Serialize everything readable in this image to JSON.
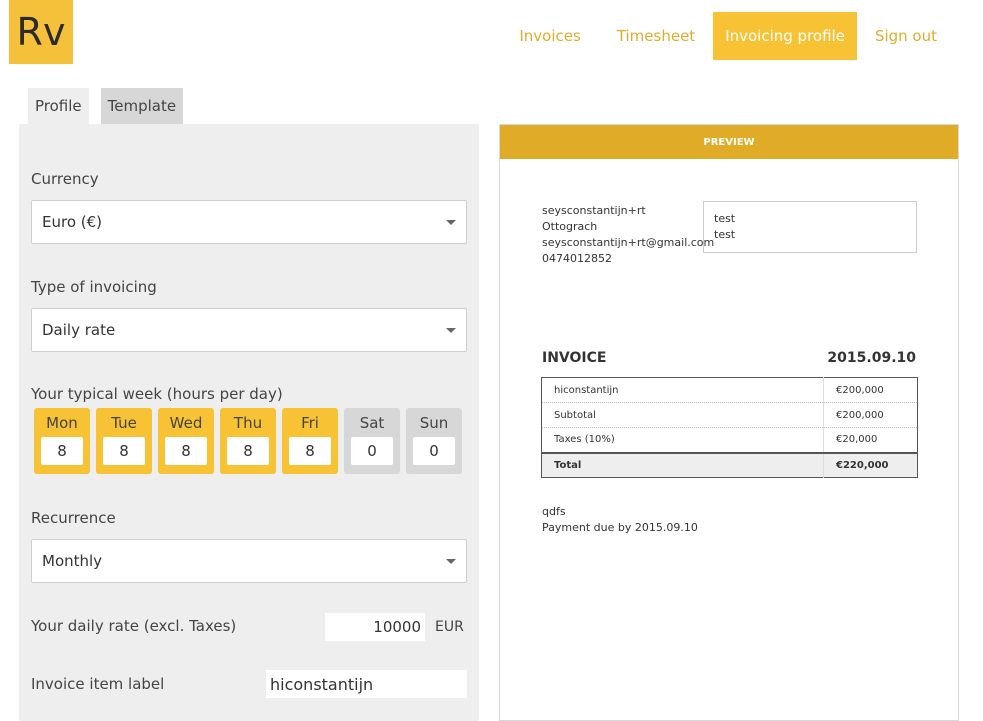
{
  "logo": {
    "text": "Rv"
  },
  "nav": {
    "items": [
      {
        "label": "Invoices"
      },
      {
        "label": "Timesheet"
      },
      {
        "label": "Invoicing profile"
      },
      {
        "label": "Sign out"
      }
    ],
    "active_index": 2
  },
  "tabs": [
    {
      "label": "Profile"
    },
    {
      "label": "Template"
    }
  ],
  "form": {
    "currency_label": "Currency",
    "currency_value": "Euro (€)",
    "invoicing_type_label": "Type of invoicing",
    "invoicing_type_value": "Daily rate",
    "week_label": "Your typical week (hours per day)",
    "days": [
      {
        "name": "Mon",
        "hours": "8",
        "active": true
      },
      {
        "name": "Tue",
        "hours": "8",
        "active": true
      },
      {
        "name": "Wed",
        "hours": "8",
        "active": true
      },
      {
        "name": "Thu",
        "hours": "8",
        "active": true
      },
      {
        "name": "Fri",
        "hours": "8",
        "active": true
      },
      {
        "name": "Sat",
        "hours": "0",
        "active": false
      },
      {
        "name": "Sun",
        "hours": "0",
        "active": false
      }
    ],
    "recurrence_label": "Recurrence",
    "recurrence_value": "Monthly",
    "rate_label": "Your daily rate (excl. Taxes)",
    "rate_value": "10000",
    "rate_unit": "EUR",
    "item_label_label": "Invoice item label",
    "item_label_value": "hiconstantijn"
  },
  "preview": {
    "header": "PREVIEW",
    "sender": {
      "name": "seysconstantijn+rt",
      "city": "Ottograch",
      "email": "seysconstantijn+rt@gmail.com",
      "phone": "0474012852"
    },
    "recipient": {
      "line1": "test",
      "line2": "test"
    },
    "title": "INVOICE",
    "date": "2015.09.10",
    "rows": [
      {
        "label": "hiconstantijn",
        "amount": "€200,000"
      },
      {
        "label": "Subtotal",
        "amount": "€200,000"
      },
      {
        "label": "Taxes (10%)",
        "amount": "€20,000"
      }
    ],
    "total": {
      "label": "Total",
      "amount": "€220,000"
    },
    "note": "qdfs",
    "payment_due": "Payment due by 2015.09.10"
  },
  "colors": {
    "accent": "#f7c234",
    "accent_dark": "#e0ac28",
    "panel_bg": "#eeeeee"
  }
}
